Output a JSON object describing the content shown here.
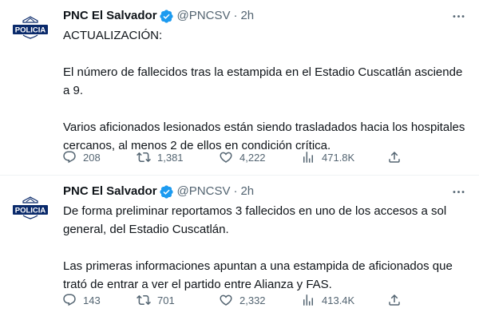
{
  "tweets": [
    {
      "avatar": {
        "text": "POLICIA",
        "icon": "police-badge-icon",
        "color": "#0a2a6b"
      },
      "author": {
        "name": "PNC El Salvador",
        "handle": "@PNCSV",
        "time": "2h",
        "verified": true,
        "verified_color": "#1d9bf0"
      },
      "paragraphs": [
        "ACTUALIZACIÓN:",
        "El número de fallecidos tras la estampida en el Estadio Cuscatlán asciende a 9.",
        "Varios aficionados lesionados están siendo trasladados hacia los hospitales cercanos, al menos 2 de ellos en condición crítica."
      ],
      "stats": {
        "replies": "208",
        "retweets": "1,381",
        "likes": "4,222",
        "views": "471.8K"
      }
    },
    {
      "avatar": {
        "text": "POLICIA",
        "icon": "police-badge-icon",
        "color": "#0a2a6b"
      },
      "author": {
        "name": "PNC El Salvador",
        "handle": "@PNCSV",
        "time": "2h",
        "verified": true,
        "verified_color": "#1d9bf0"
      },
      "paragraphs": [
        "De forma preliminar reportamos 3 fallecidos en uno de los accesos a sol general, del Estadio Cuscatlán.",
        "Las primeras informaciones apuntan a una estampida de aficionados que trató de entrar a ver el partido entre Alianza y FAS."
      ],
      "stats": {
        "replies": "143",
        "retweets": "701",
        "likes": "2,332",
        "views": "413.4K"
      }
    }
  ],
  "separator": "·",
  "colors": {
    "text": "#0f1419",
    "secondary": "#536471",
    "divider": "#eff3f4"
  }
}
